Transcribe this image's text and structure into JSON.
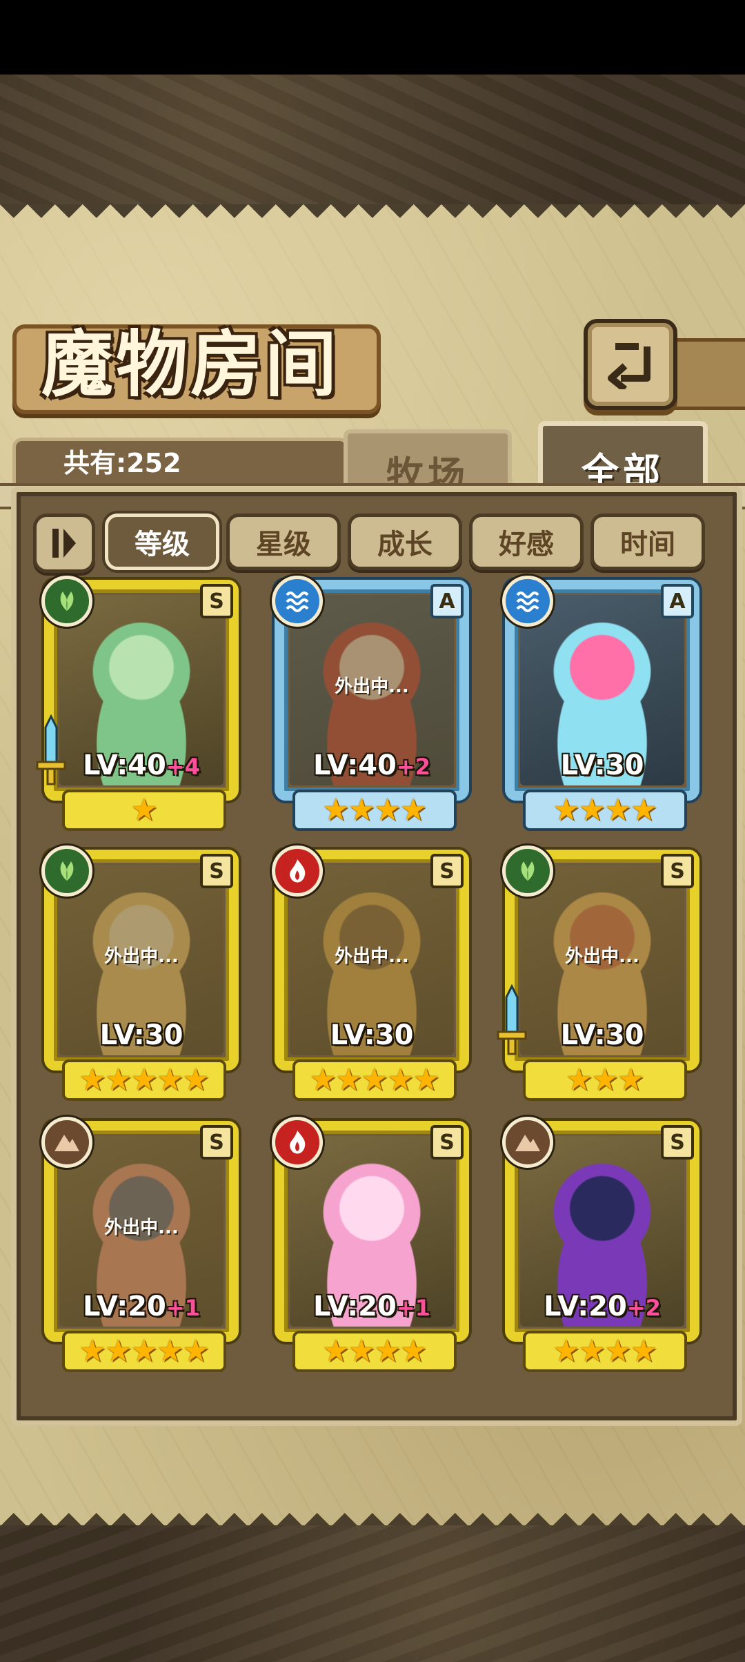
{
  "title": "魔物房间",
  "count_label": "共有:252",
  "tabs": {
    "ranch": "牧场",
    "all": "全部"
  },
  "filters": [
    "等级",
    "星级",
    "成长",
    "好感",
    "时间"
  ],
  "active_filter": "等级",
  "away_label": "外出中...",
  "monsters": [
    {
      "element": "leaf",
      "rank": "S",
      "level": "LV:40",
      "bonus": "+4",
      "stars": 1,
      "away": false,
      "weapon": true,
      "frame": "gold",
      "palette": [
        "#7fc58a",
        "#b8e3b0"
      ]
    },
    {
      "element": "water",
      "rank": "A",
      "level": "LV:40",
      "bonus": "+2",
      "stars": 4,
      "away": true,
      "weapon": false,
      "frame": "blue",
      "palette": [
        "#c0443a",
        "#f2d7c4"
      ]
    },
    {
      "element": "water",
      "rank": "A",
      "level": "LV:30",
      "bonus": "",
      "stars": 4,
      "away": false,
      "weapon": false,
      "frame": "blue",
      "palette": [
        "#8fe0f0",
        "#ff6fa8"
      ]
    },
    {
      "element": "leaf",
      "rank": "S",
      "level": "LV:30",
      "bonus": "",
      "stars": 5,
      "away": true,
      "weapon": false,
      "frame": "gold",
      "palette": [
        "#f0c870",
        "#fbe8b8"
      ]
    },
    {
      "element": "fire",
      "rank": "S",
      "level": "LV:30",
      "bonus": "",
      "stars": 5,
      "away": true,
      "weapon": false,
      "frame": "gold",
      "palette": [
        "#e0b04c",
        "#8a6a3a"
      ]
    },
    {
      "element": "leaf",
      "rank": "S",
      "level": "LV:30",
      "bonus": "",
      "stars": 3,
      "away": true,
      "weapon": true,
      "frame": "gold",
      "palette": [
        "#f8c060",
        "#e07848"
      ]
    },
    {
      "element": "earth",
      "rank": "S",
      "level": "LV:20",
      "bonus": "+1",
      "stars": 5,
      "away": true,
      "weapon": false,
      "frame": "gold",
      "palette": [
        "#f29a7a",
        "#6b7080"
      ]
    },
    {
      "element": "fire",
      "rank": "S",
      "level": "LV:20",
      "bonus": "+1",
      "stars": 4,
      "away": false,
      "weapon": false,
      "frame": "gold",
      "palette": [
        "#f7a3cf",
        "#ffd9ee"
      ]
    },
    {
      "element": "earth",
      "rank": "S",
      "level": "LV:20",
      "bonus": "+2",
      "stars": 4,
      "away": false,
      "weapon": false,
      "frame": "gold",
      "palette": [
        "#7a3ab8",
        "#2a2a5e"
      ]
    }
  ]
}
